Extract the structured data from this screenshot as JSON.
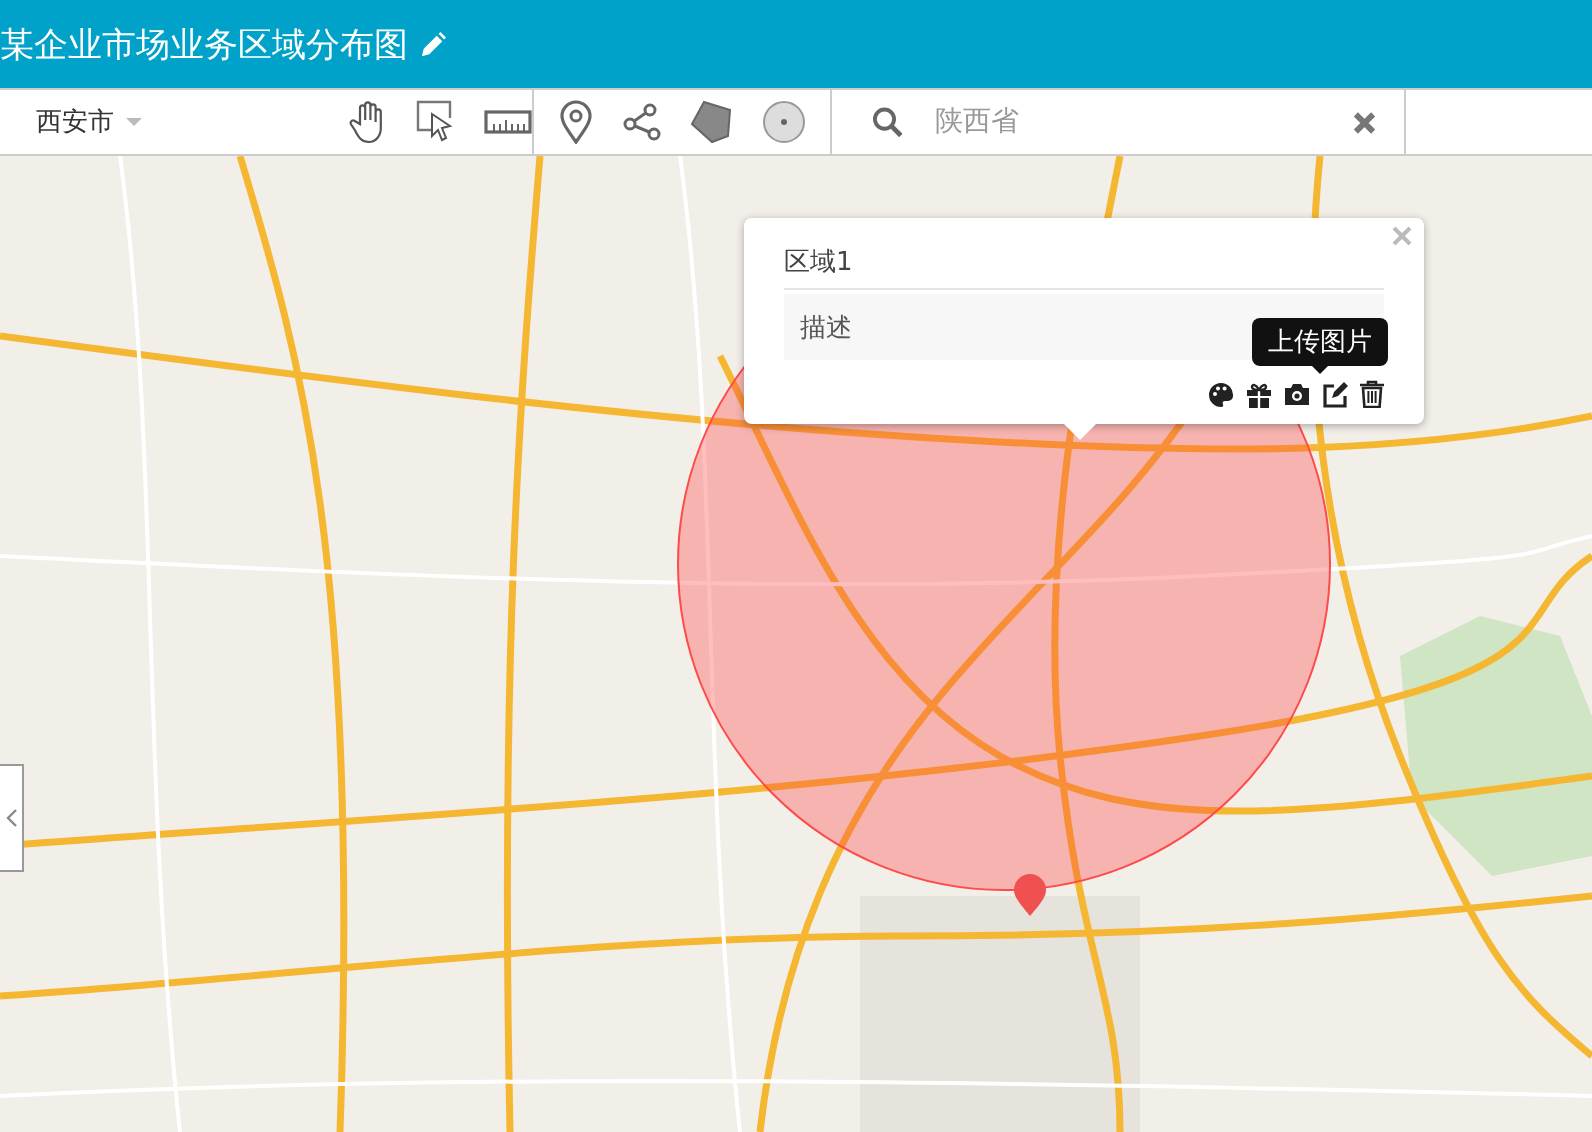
{
  "header": {
    "title": "某企业市场业务区域分布图"
  },
  "toolbar": {
    "city": "西安市"
  },
  "search": {
    "placeholder": "陕西省"
  },
  "popup": {
    "title": "区域1",
    "description_placeholder": "描述",
    "tooltip": "上传图片"
  }
}
